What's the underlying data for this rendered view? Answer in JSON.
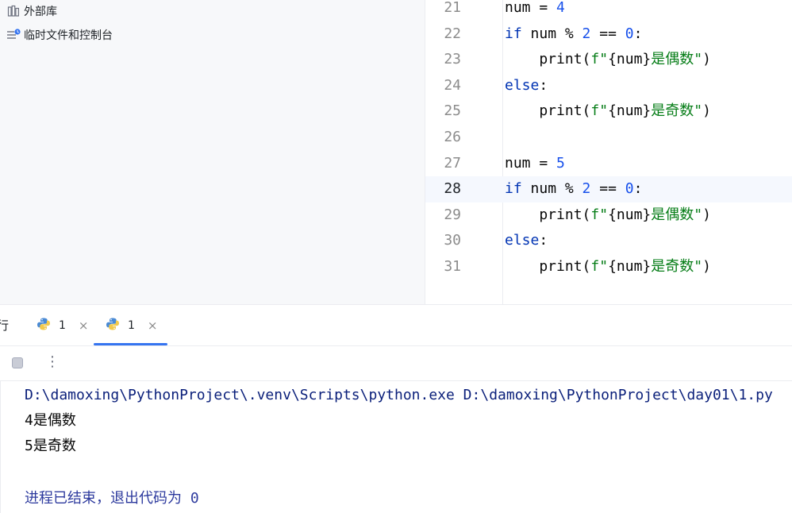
{
  "project": {
    "items": [
      {
        "label": "外部库",
        "icon": "library-icon"
      },
      {
        "label": "临时文件和控制台",
        "icon": "scratches-icon"
      }
    ]
  },
  "editor": {
    "current_line": "28",
    "lines": [
      {
        "n": "21",
        "tokens": [
          [
            "num = ",
            ""
          ],
          [
            "4",
            "num"
          ]
        ]
      },
      {
        "n": "22",
        "tokens": [
          [
            "if",
            "kw"
          ],
          [
            " num % ",
            ""
          ],
          [
            "2",
            "num"
          ],
          [
            " == ",
            ""
          ],
          [
            "0",
            "num"
          ],
          [
            ":",
            ""
          ]
        ]
      },
      {
        "n": "23",
        "tokens": [
          [
            "    print(",
            ""
          ],
          [
            "f\"",
            "str"
          ],
          [
            "{num}",
            ""
          ],
          [
            "是偶数\"",
            "str"
          ],
          [
            ")",
            ""
          ]
        ]
      },
      {
        "n": "24",
        "tokens": [
          [
            "else",
            "kw"
          ],
          [
            ":",
            ""
          ]
        ]
      },
      {
        "n": "25",
        "tokens": [
          [
            "    print(",
            ""
          ],
          [
            "f\"",
            "str"
          ],
          [
            "{num}",
            ""
          ],
          [
            "是奇数\"",
            "str"
          ],
          [
            ")",
            ""
          ]
        ]
      },
      {
        "n": "26",
        "tokens": []
      },
      {
        "n": "27",
        "tokens": [
          [
            "num = ",
            ""
          ],
          [
            "5",
            "num"
          ]
        ]
      },
      {
        "n": "28",
        "tokens": [
          [
            "if",
            "kw"
          ],
          [
            " num % ",
            ""
          ],
          [
            "2",
            "num"
          ],
          [
            " == ",
            ""
          ],
          [
            "0",
            "num"
          ],
          [
            ":",
            ""
          ]
        ]
      },
      {
        "n": "29",
        "tokens": [
          [
            "    print(",
            ""
          ],
          [
            "f\"",
            "str"
          ],
          [
            "{num}",
            ""
          ],
          [
            "是偶数\"",
            "str"
          ],
          [
            ")",
            ""
          ]
        ]
      },
      {
        "n": "30",
        "tokens": [
          [
            "else",
            "kw"
          ],
          [
            ":",
            ""
          ]
        ]
      },
      {
        "n": "31",
        "tokens": [
          [
            "    print(",
            ""
          ],
          [
            "f\"",
            "str"
          ],
          [
            "{num}",
            ""
          ],
          [
            "是奇数\"",
            "str"
          ],
          [
            ")",
            ""
          ]
        ]
      }
    ]
  },
  "run": {
    "partial_tab": "行",
    "tabs": [
      {
        "label": "1",
        "close": "×",
        "active": false
      },
      {
        "label": "1",
        "close": "×",
        "active": true
      }
    ],
    "more_glyph": "⋮"
  },
  "console": {
    "command": "D:\\damoxing\\PythonProject\\.venv\\Scripts\\python.exe D:\\damoxing\\PythonProject\\day01\\1.py",
    "output": [
      "4是偶数",
      "5是奇数"
    ],
    "exit": "进程已结束，退出代码为 0"
  },
  "colors": {
    "keyword": "#0033b3",
    "number": "#1750eb",
    "string": "#067d17",
    "accent": "#3574f0"
  }
}
